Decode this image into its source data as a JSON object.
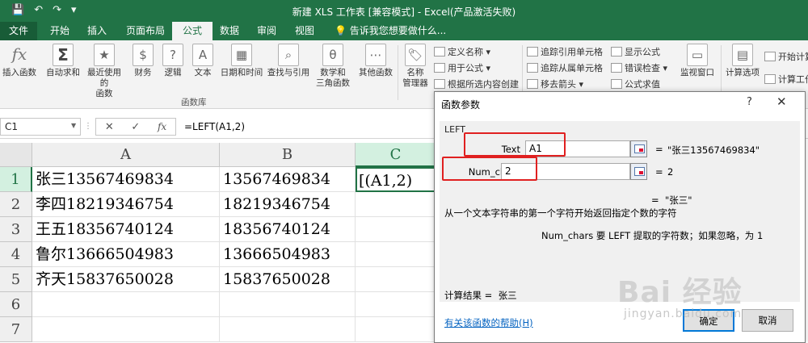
{
  "window": {
    "title": "新建 XLS 工作表 [兼容模式] - Excel(产品激活失败)"
  },
  "qat": {
    "save": "💾",
    "undo": "↶",
    "redo": "↷",
    "more": "▾"
  },
  "tabs": {
    "file": "文件",
    "items": [
      "开始",
      "插入",
      "页面布局",
      "公式",
      "数据",
      "审阅",
      "视图"
    ],
    "active": "公式",
    "tellme": "告诉我您想要做什么..."
  },
  "ribbon": {
    "insert_function": "插入函数",
    "autosum": "自动求和",
    "recent_line1": "最近使用的",
    "recent_line2": "函数",
    "financial": "财务",
    "logical": "逻辑",
    "text": "文本",
    "datetime": "日期和时间",
    "lookup": "查找与引用",
    "math_line1": "数学和",
    "math_line2": "三角函数",
    "more_functions": "其他函数",
    "name_mgr_line1": "名称",
    "name_mgr_line2": "管理器",
    "define_name": "定义名称",
    "use_in_formula": "用于公式",
    "create_from_sel": "根据所选内容创建",
    "trace_precedents": "追踪引用单元格",
    "trace_dependents": "追踪从属单元格",
    "remove_arrows": "移去箭头",
    "show_formulas": "显示公式",
    "error_check": "错误检查",
    "evaluate": "公式求值",
    "watch_window": "监视窗口",
    "calc_options": "计算选项",
    "calc_now": "开始计算",
    "calc_sheet": "计算工作",
    "group_label": "函数库"
  },
  "formula_bar": {
    "name_box": "C1",
    "cancel": "✕",
    "enter": "✓",
    "fx": "fx",
    "formula": "=LEFT(A1,2)"
  },
  "sheet": {
    "columns": [
      "A",
      "B",
      "C"
    ],
    "rows": [
      "1",
      "2",
      "3",
      "4",
      "5",
      "6",
      "7"
    ],
    "cells": {
      "A": [
        "张三13567469834",
        "李四18219346754",
        "王五18356740124",
        "鲁尔13666504983",
        "齐天15837650028",
        "",
        ""
      ],
      "B": [
        "13567469834",
        "18219346754",
        "18356740124",
        "13666504983",
        "15837650028",
        "",
        ""
      ],
      "C": [
        "[(A1,2)",
        "",
        "",
        "",
        "",
        "",
        ""
      ]
    },
    "active_cell": "C1"
  },
  "dialog": {
    "title": "函数参数",
    "help": "?",
    "close": "✕",
    "function_name": "LEFT",
    "args": [
      {
        "label": "Text",
        "value": "A1",
        "result": "\"张三13567469834\""
      },
      {
        "label": "Num_chars",
        "value": "2",
        "result": "2"
      }
    ],
    "eq": "=",
    "formula_result": "\"张三\"",
    "description": "从一个文本字符串的第一个字符开始返回指定个数的字符",
    "arg_description": "Num_chars  要 LEFT 提取的字符数；如果忽略，为 1",
    "calc_result_label": "计算结果 =",
    "calc_result_value": "张三",
    "help_link": "有关该函数的帮助(H)",
    "ok": "确定",
    "cancel": "取消"
  },
  "watermark": {
    "text": "Bai 经验",
    "url": "jingyan.baidu.com"
  },
  "colors": {
    "excel_green": "#217346",
    "highlight_red": "#e02020",
    "link_blue": "#0563c1"
  }
}
